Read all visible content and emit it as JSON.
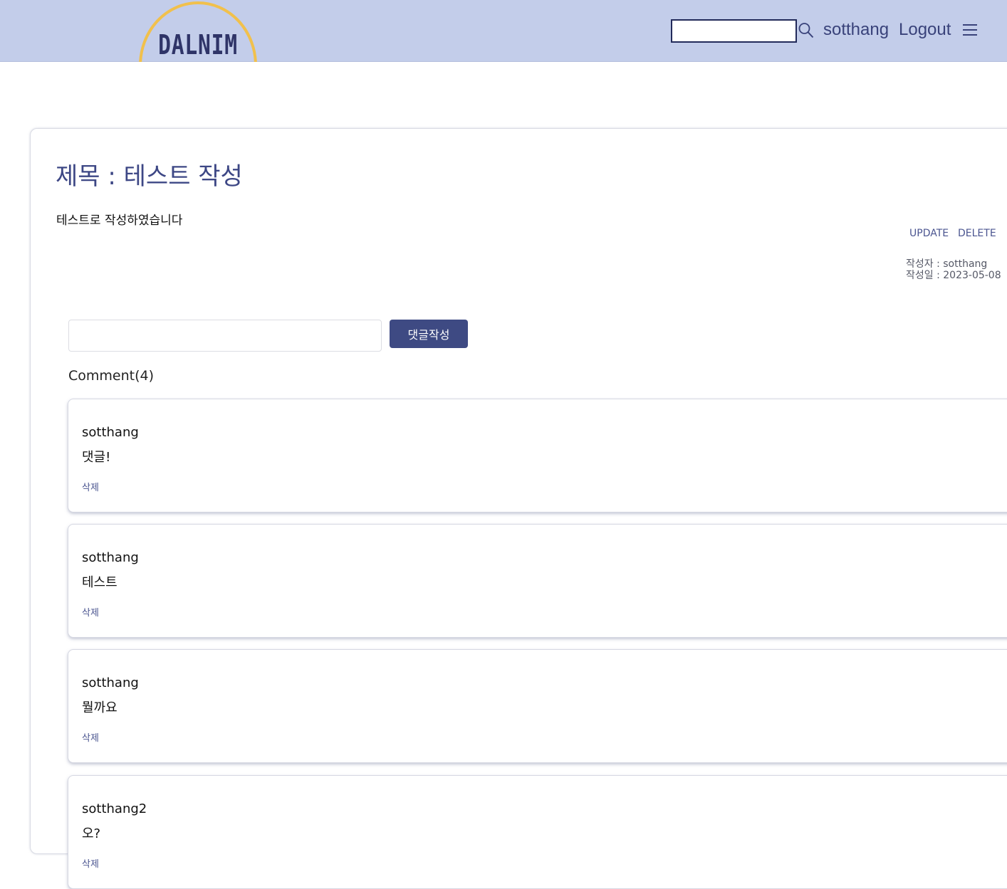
{
  "header": {
    "logo_text": "DALNIM",
    "search": {
      "value": "",
      "placeholder": ""
    },
    "username": "sotthang",
    "logout_label": "Logout",
    "colors": {
      "background": "#c3cdea",
      "accent": "#39427a",
      "logo_arc": "#f1c04c"
    }
  },
  "post": {
    "title": "제목 : 테스트 작성",
    "body": "테스트로 작성하였습니다",
    "update_label": "UPDATE",
    "delete_label": "DELETE",
    "author_line": "작성자 : sotthang",
    "date_line": "작성일 : 2023-05-08"
  },
  "comment_form": {
    "input_value": "",
    "input_placeholder": "",
    "submit_label": "댓글작성"
  },
  "comments_header": "Comment(4)",
  "comments": [
    {
      "author": "sotthang",
      "text": "댓글!",
      "delete_label": "삭제"
    },
    {
      "author": "sotthang",
      "text": "테스트",
      "delete_label": "삭제"
    },
    {
      "author": "sotthang",
      "text": "뭘까요",
      "delete_label": "삭제"
    },
    {
      "author": "sotthang2",
      "text": "오?",
      "delete_label": "삭제"
    }
  ]
}
